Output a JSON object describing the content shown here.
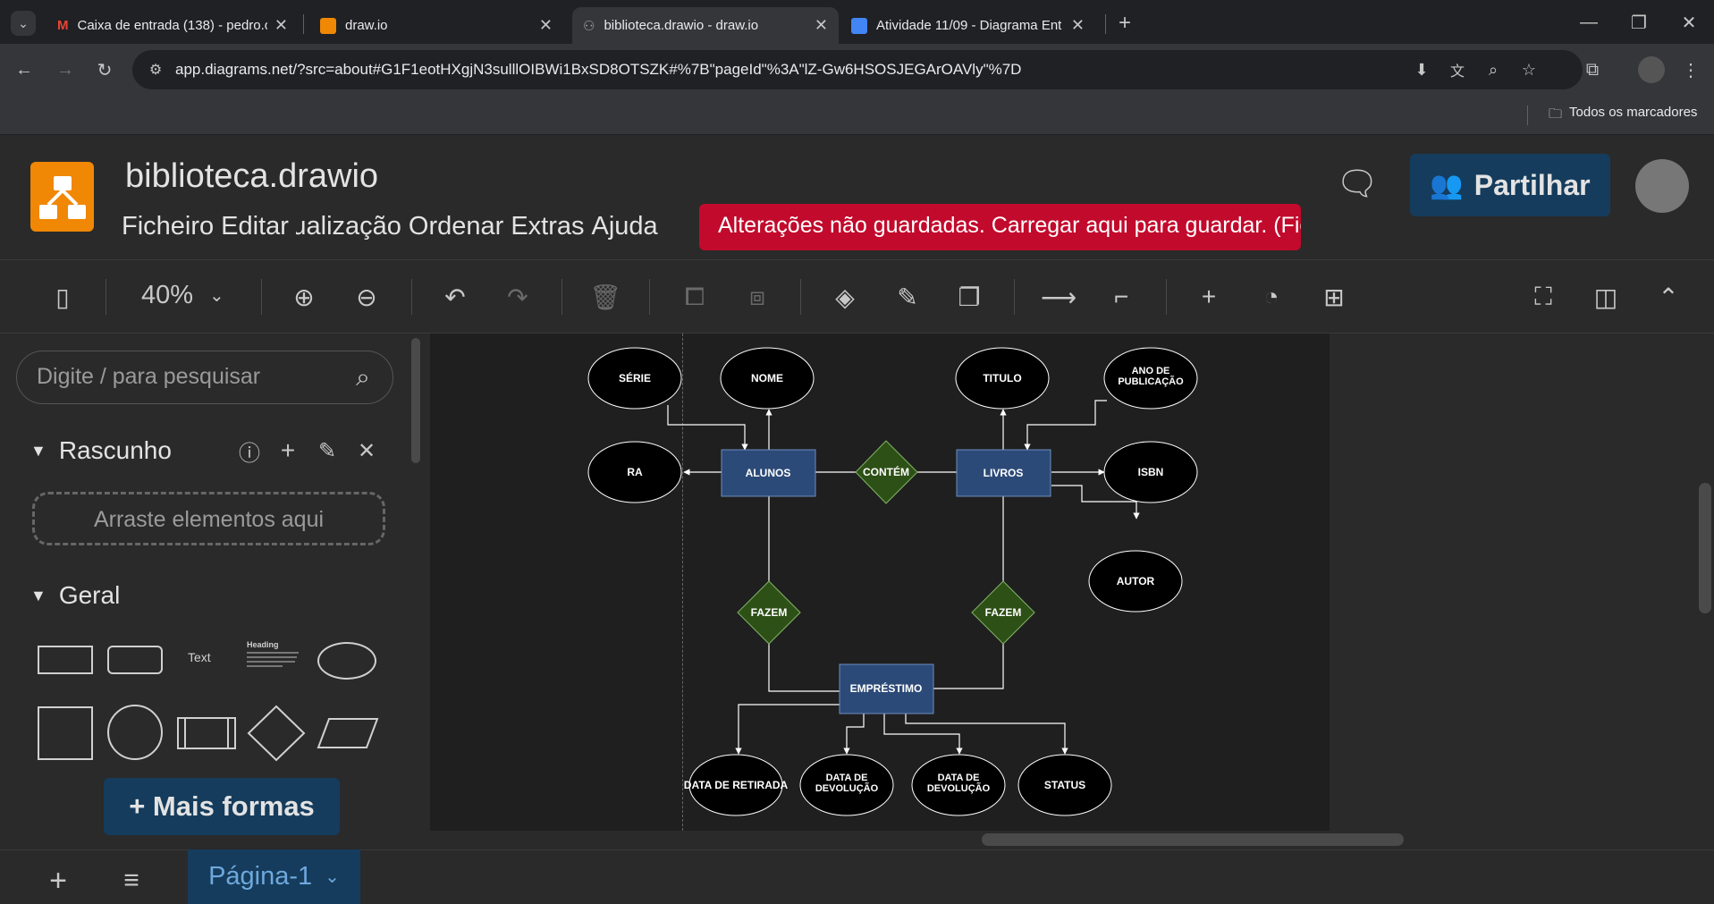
{
  "browser": {
    "tabs": [
      {
        "title": "Caixa de entrada (138) - pedro.o",
        "icon": "gmail-icon"
      },
      {
        "title": "draw.io",
        "icon": "drawio-icon"
      },
      {
        "title": "biblioteca.drawio - draw.io",
        "icon": "drawio-icon",
        "active": true
      },
      {
        "title": "Atividade 11/09 - Diagrama Ent",
        "icon": "classroom-icon"
      }
    ],
    "url": "app.diagrams.net/?src=about#G1F1eotHXgjN3sulllOIBWi1BxSD8OTSZK#%7B\"pageId\"%3A\"lZ-Gw6HSOSJEGArOAVly\"%7D",
    "bookmarks_label": "Todos os marcadores"
  },
  "app": {
    "filename": "biblioteca.drawio",
    "menu": [
      "Ficheiro",
      "Editar",
      "Visualização",
      "Ordenar",
      "Extras",
      "Ajuda"
    ],
    "unsaved_banner": "Alterações não guardadas. Carregar aqui para guardar. (Ficheiro)",
    "share_label": "Partilhar",
    "zoom": "40%",
    "search_placeholder": "Digite / para pesquisar",
    "scratchpad_title": "Rascunho",
    "drop_hint": "Arraste elementos aqui",
    "general_title": "Geral",
    "shape_text": "Text",
    "shape_heading": "Heading",
    "more_shapes": "+ Mais formas",
    "page_tab": "Página-1"
  },
  "diagram": {
    "entities": [
      "ALUNOS",
      "LIVROS",
      "EMPRÉSTIMO"
    ],
    "relationships": [
      "CONTÉM",
      "FAZEM",
      "FAZEM"
    ],
    "attributes": [
      "SÉRIE",
      "NOME",
      "TITULO",
      "ANO DE PUBLICAÇÃO",
      "RA",
      "ISBN",
      "AUTOR",
      "DATA DE RETIRADA",
      "DATA DE DEVOLUÇÃO",
      "DATA DE DEVOLUÇÃO",
      "STATUS"
    ]
  },
  "colors": {
    "entity": "#2c4a78",
    "relationship": "#2d5016",
    "banner": "#c20a2c",
    "accent": "#153c5c",
    "logo": "#f08705"
  }
}
